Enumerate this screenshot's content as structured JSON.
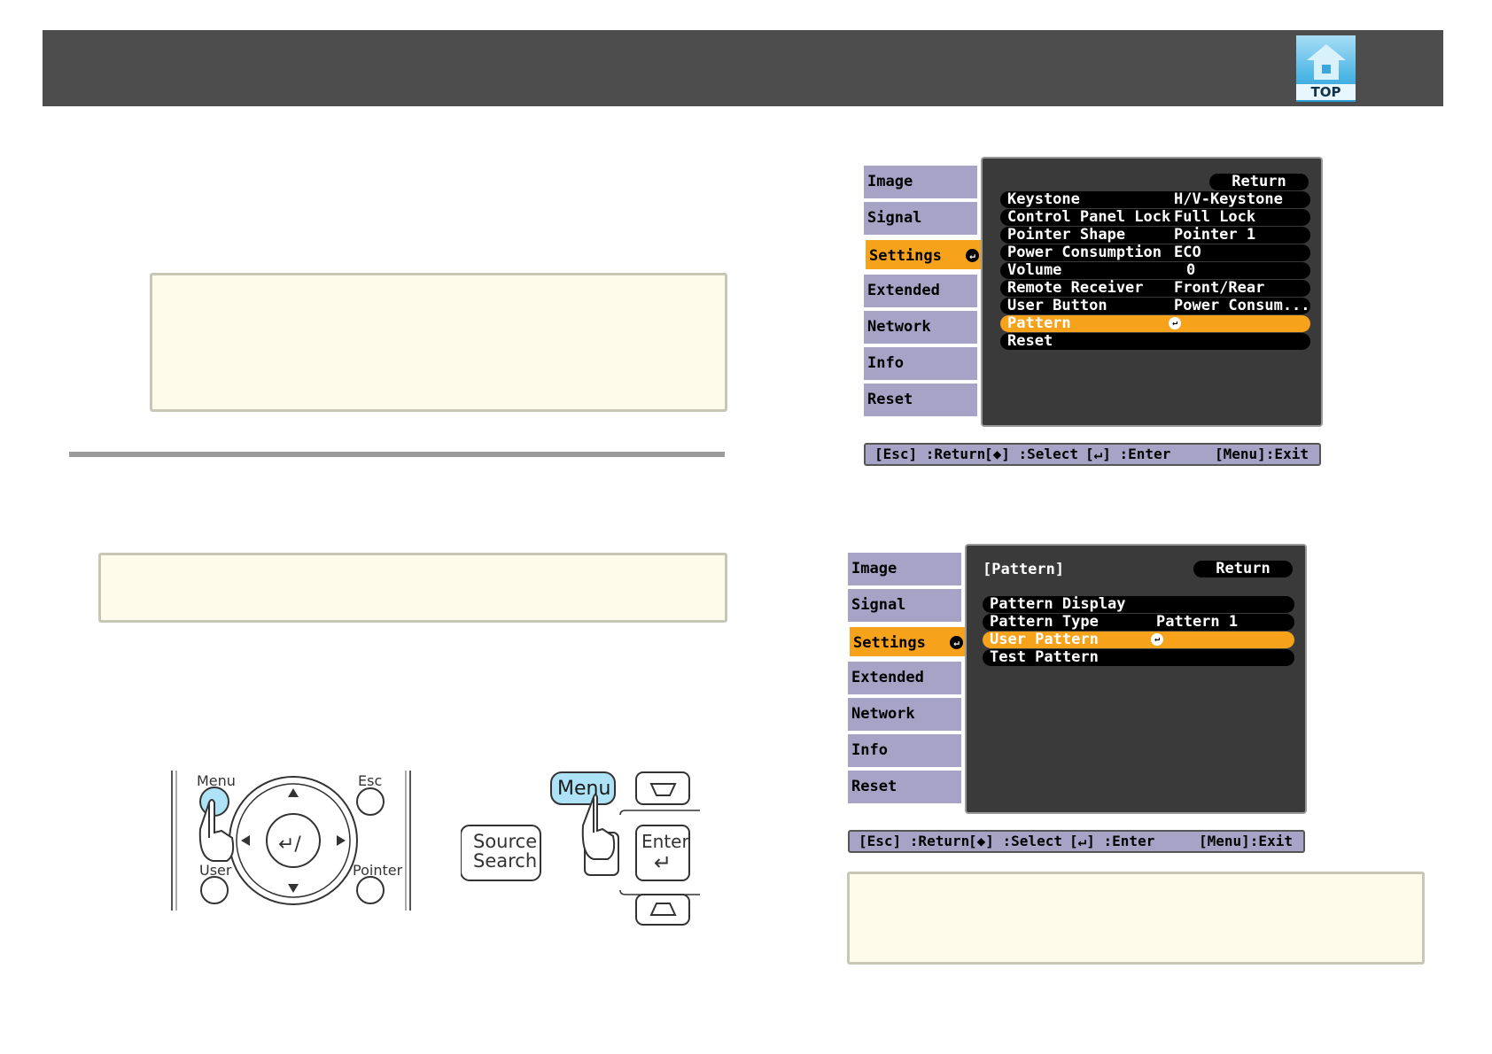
{
  "header": {
    "logo_text": "TOP"
  },
  "menu1": {
    "tabs": [
      "Image",
      "Signal",
      "Settings",
      "Extended",
      "Network",
      "Info",
      "Reset"
    ],
    "active_tab": "Settings",
    "return_label": "Return",
    "rows": [
      {
        "label": "Keystone",
        "value": "H/V-Keystone"
      },
      {
        "label": "Control Panel Lock",
        "value": "Full Lock"
      },
      {
        "label": "Pointer Shape",
        "value": "Pointer 1"
      },
      {
        "label": "Power Consumption",
        "value": "ECO"
      },
      {
        "label": "Volume",
        "value": "0"
      },
      {
        "label": "Remote Receiver",
        "value": "Front/Rear"
      },
      {
        "label": "User Button",
        "value": "Power Consum..."
      },
      {
        "label": "Pattern",
        "value": ""
      },
      {
        "label": "Reset",
        "value": ""
      }
    ],
    "selected_row": "Pattern",
    "footer": {
      "esc": "[Esc] :Return",
      "select": "[◆] :Select",
      "enter": "[↵] :Enter",
      "exit": "[Menu]:Exit"
    }
  },
  "menu2": {
    "tabs": [
      "Image",
      "Signal",
      "Settings",
      "Extended",
      "Network",
      "Info",
      "Reset"
    ],
    "active_tab": "Settings",
    "title": "[Pattern]",
    "return_label": "Return",
    "rows": [
      {
        "label": "Pattern Display",
        "value": ""
      },
      {
        "label": "Pattern Type",
        "value": "Pattern 1"
      },
      {
        "label": "User Pattern",
        "value": ""
      },
      {
        "label": "Test Pattern",
        "value": ""
      }
    ],
    "selected_row": "User Pattern",
    "footer": {
      "esc": "[Esc] :Return",
      "select": "[◆] :Select",
      "enter": "[↵] :Enter",
      "exit": "[Menu]:Exit"
    }
  },
  "remote": {
    "menu": "Menu",
    "esc": "Esc",
    "user": "User",
    "pointer": "Pointer"
  },
  "control_panel": {
    "menu": "Menu",
    "source_line1": "Source",
    "source_line2": "Search",
    "enter": "Enter"
  }
}
